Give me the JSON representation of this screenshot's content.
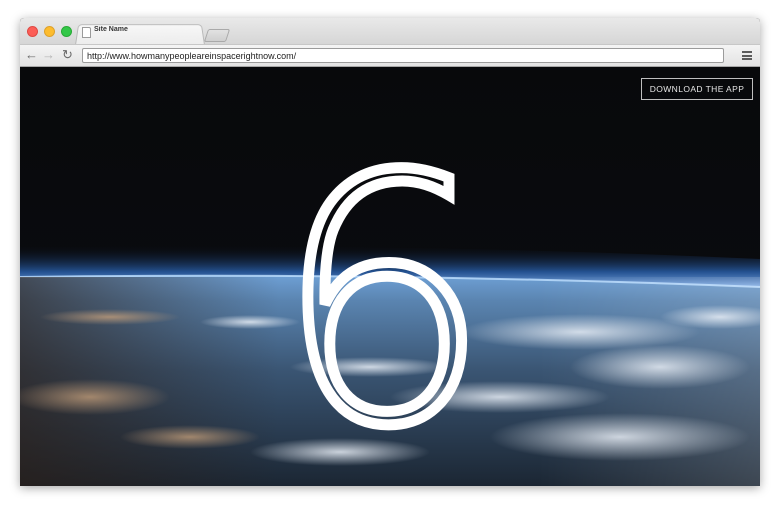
{
  "browser": {
    "tab_title": "Site Name",
    "url": "http://www.howmanypeopleareinspacerightnow.com/"
  },
  "page": {
    "count": "6",
    "download_label": "DOWNLOAD THE APP"
  },
  "icons": {
    "back": "back-arrow-icon",
    "forward": "forward-arrow-icon",
    "reload": "reload-icon",
    "menu": "hamburger-menu-icon",
    "page": "page-icon"
  },
  "colors": {
    "space": "#050608",
    "atmosphere": "#4f8fe0",
    "number": "#ffffff"
  }
}
